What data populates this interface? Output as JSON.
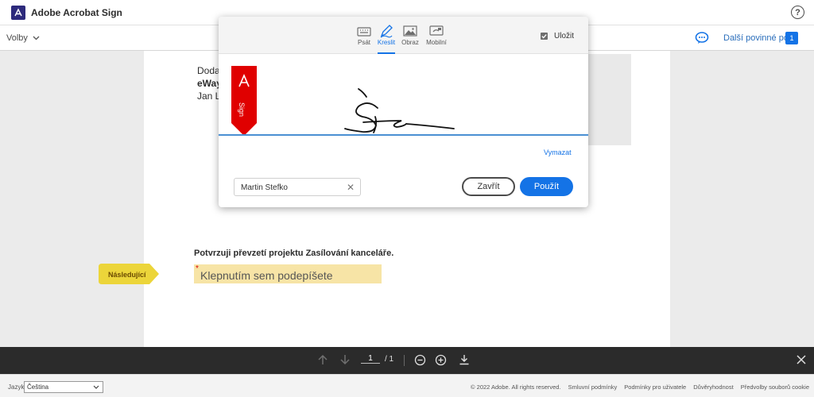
{
  "app": {
    "title": "Adobe Acrobat Sign"
  },
  "help": {
    "label": "?"
  },
  "subbar": {
    "options_label": "Volby",
    "next_required_label": "Další povinné pole",
    "next_required_count": "1"
  },
  "document": {
    "lines": [
      "Doda",
      "eWay",
      "Jan L"
    ],
    "confirm_text": "Potvrzuji převzetí projektu Zasílování kanceláře.",
    "signature_placeholder": "Klepnutím sem podepíšete",
    "required_marker": "*",
    "next_tag_label": "Následující"
  },
  "modal": {
    "tabs": [
      {
        "label": "Psát",
        "icon": "keyboard-icon"
      },
      {
        "label": "Kreslit",
        "icon": "pen-icon",
        "active": true
      },
      {
        "label": "Obraz",
        "icon": "image-icon"
      },
      {
        "label": "Mobilní",
        "icon": "mobile-icon"
      }
    ],
    "save_label": "Uložit",
    "save_checked": true,
    "ribbon_label": "Sign",
    "clear_label": "Vymazat",
    "name_value": "Martin Stefko",
    "close_label": "Zavřít",
    "apply_label": "Použít"
  },
  "toolbar": {
    "page_current": "1",
    "page_total": "/ 1"
  },
  "footer": {
    "language_label": "Jazyk",
    "language_value": "Čeština",
    "copyright": "© 2022 Adobe. All rights reserved.",
    "links": [
      "Smluvní podmínky",
      "Podmínky pro uživatele",
      "Důvěryhodnost",
      "Předvolby souborů cookie"
    ]
  },
  "colors": {
    "accent": "#1473e6",
    "ribbon": "#e00000",
    "sign_field": "#f7e4a6",
    "next_tag": "#ecd53a",
    "toolbar": "#2b2b2b"
  }
}
